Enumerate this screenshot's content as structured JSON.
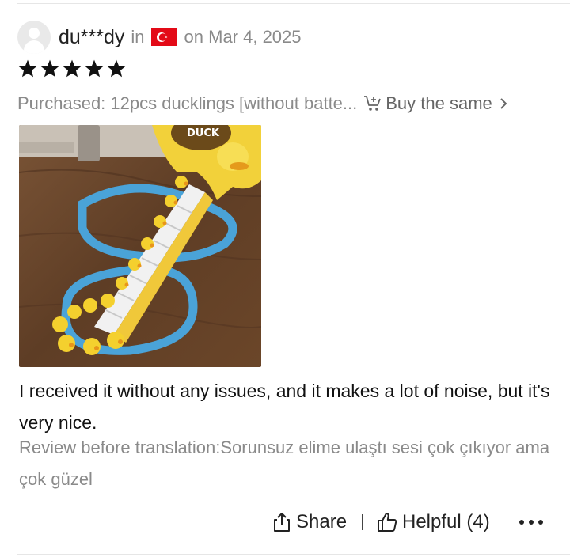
{
  "review": {
    "username": "du***dy",
    "in_label": "in",
    "country_flag": "turkey-flag",
    "date": "on Mar 4, 2025",
    "rating": 5,
    "purchased": "Purchased: 12pcs ducklings [without batte...",
    "buy_same_label": "Buy the same",
    "photo_label": "DUCK",
    "text": "I received it without any issues, and it makes a lot of noise, but it's very nice.",
    "original_text": "Review before translation:Sorunsuz elime ulaştı sesi çok çıkıyor ama çok güzel"
  },
  "actions": {
    "share_label": "Share",
    "helpful_label": "Helpful (4)"
  },
  "colors": {
    "muted_text": "#8a8a8a",
    "flag_red": "#e30a17",
    "star": "#111111"
  }
}
